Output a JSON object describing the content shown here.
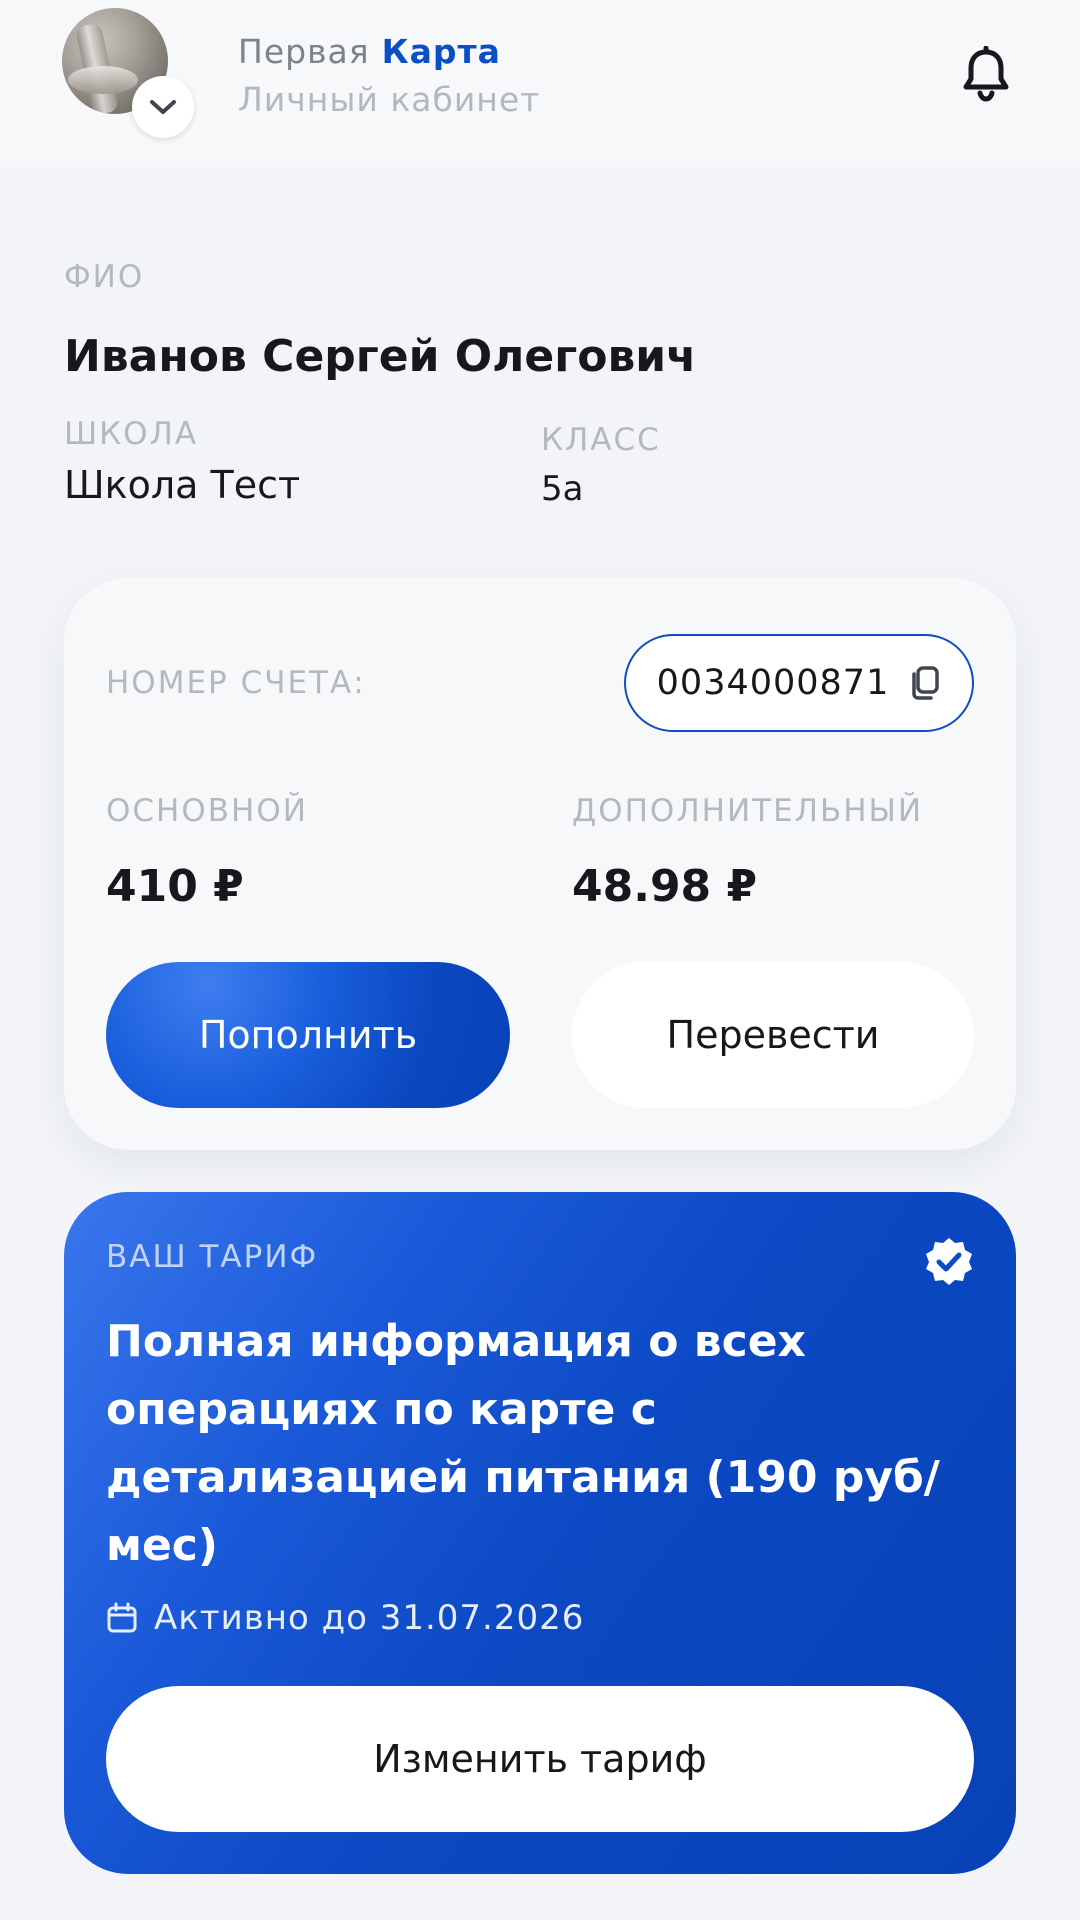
{
  "header": {
    "brand_first": "Первая",
    "brand_second": "Карта",
    "subtitle": "Личный кабинет"
  },
  "profile": {
    "fio_label": "ФИО",
    "fio_value": "Иванов Сергей Олегович",
    "school_label": "ШКОЛА",
    "school_value": "Школа Тест",
    "class_label": "КЛАСС",
    "class_value": "5а"
  },
  "account": {
    "number_label": "НОМЕР СЧЕТА:",
    "number_value": "0034000871",
    "main_label": "ОСНОВНОЙ",
    "main_value": "410 ₽",
    "extra_label": "ДОПОЛНИТЕЛЬНЫЙ",
    "extra_value": "48.98 ₽",
    "topup_button": "Пополнить",
    "transfer_button": "Перевести"
  },
  "tariff": {
    "label": "ВАШ ТАРИФ",
    "title": "Полная информация о всех операциях по карте с детализацией питания (190 руб/мес)",
    "active_until": "Активно до 31.07.2026",
    "change_button": "Изменить тариф"
  },
  "colors": {
    "accent": "#0b4fc4",
    "background": "#f2f4f7",
    "card": "#f7f8fa",
    "muted_text": "#b4b9c0"
  },
  "icons": [
    "avatar-chevron-down-icon",
    "bell-icon",
    "copy-icon",
    "verified-badge-icon",
    "calendar-icon"
  ]
}
